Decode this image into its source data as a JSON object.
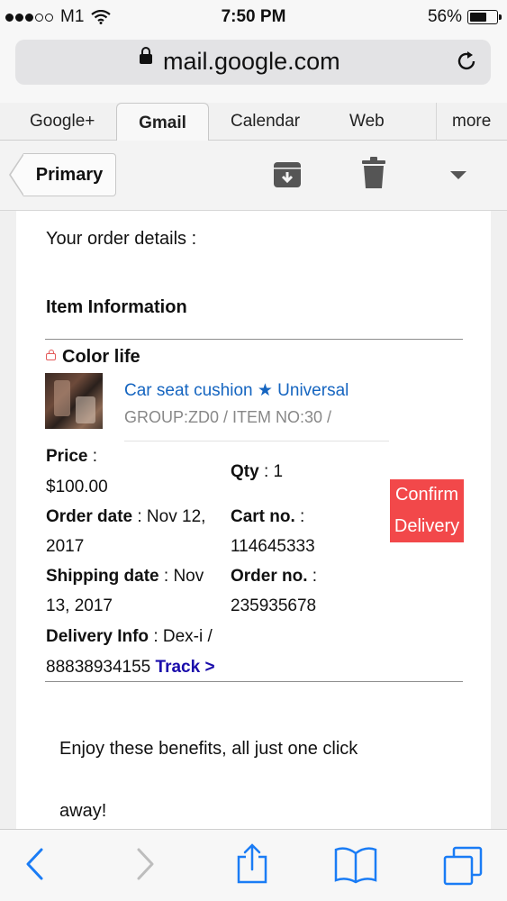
{
  "status_bar": {
    "carrier": "M1",
    "time": "7:50 PM",
    "battery": "56%",
    "battery_level": 0.56
  },
  "browser": {
    "url": "mail.google.com"
  },
  "tabs": [
    {
      "label": "Google+"
    },
    {
      "label": "Gmail",
      "active": true
    },
    {
      "label": "Calendar"
    },
    {
      "label": "Web"
    },
    {
      "label": "more"
    }
  ],
  "toolbar": {
    "back_label": "Primary"
  },
  "email": {
    "intro": "Your order details :",
    "section_title": "Item Information",
    "shop_name": "Color life",
    "item_name": "Car seat cushion ★ Universal",
    "item_meta": "GROUP:ZD0 / ITEM NO:30 /",
    "price_label": "Price",
    "price_sep": " :",
    "price_value": "$100.00",
    "qty_label": "Qty",
    "qty_value": " : 1",
    "order_date_label": "Order date",
    "order_date_value_1": " : Nov 12,",
    "order_date_value_2": "2017",
    "cart_label": "Cart no.",
    "cart_sep": " :",
    "cart_value": "114645333",
    "ship_label": "Shipping date",
    "ship_value_1": " : Nov",
    "ship_value_2": "13, 2017",
    "order_no_label": "Order no.",
    "order_no_sep": " :",
    "order_no_value": "235935678",
    "delivery_label": "Delivery Info",
    "delivery_value_1": " : Dex-i /",
    "delivery_value_2": "88838934155",
    "track_label": "Track >",
    "confirm_line1": "Confirm",
    "confirm_line2": "Delivery",
    "benefits_line1": "Enjoy these benefits, all just one click",
    "benefits_line2": "away!"
  },
  "colors": {
    "confirm_button": "#f2484a",
    "link_blue": "#1565c0",
    "track_blue": "#1a0dab",
    "ios_blue": "#1a7cf5"
  },
  "icons": [
    "lock-icon",
    "reload-icon",
    "archive-icon",
    "trash-icon",
    "dropdown-arrow-icon",
    "back-icon",
    "forward-icon",
    "share-icon",
    "bookmarks-icon",
    "tabs-icon",
    "shop-icon"
  ]
}
